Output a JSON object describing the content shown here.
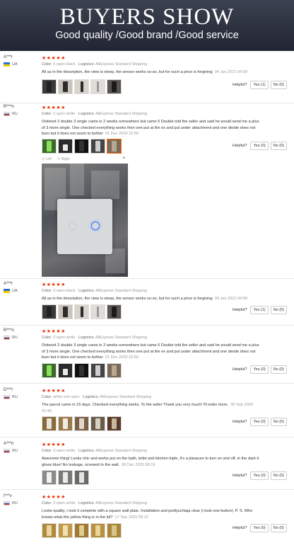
{
  "banner": {
    "title": "BUYERS SHOW",
    "subtitle": "Good quality /Good brand /Good service"
  },
  "labels": {
    "color": "Color:",
    "logistics": "Logistics:",
    "helpful": "Helpful?"
  },
  "viewer": {
    "left": "Left",
    "right": "Right",
    "close": "×"
  },
  "colors": {
    "star": "#e62e04",
    "accent": "#ff6a00"
  },
  "reviews": [
    {
      "author": "A***r",
      "country": "UA",
      "stars": "★★★★★",
      "color": "3 open black",
      "logistics": "AliExpress Standard Shipping",
      "text": "All as in the description, the view is steep, the sensor works so-so, but for such a price is forgiving",
      "date": "04 Jan 2021 04:58",
      "yes": "Yes (1)",
      "no": "No (0)"
    },
    {
      "author": "R***n",
      "country": "RU",
      "stars": "★★★★★",
      "color": "2 open white",
      "logistics": "AliExpress Standard Shipping",
      "text": "Ordered 2 double 3 single came in 2 weeks somewhere but came 5 Double told the seller and said he would send me a plus of 3 more single. One checked everything works then one put at the ex and put under attachment and one deode does not burn but it does not seem to bother",
      "date": "01 Dec 2020 22:50",
      "yes": "Yes (0)",
      "no": "No (0)"
    },
    {
      "author": "A***r",
      "country": "UA",
      "stars": "★★★★★",
      "color": "3 open black",
      "logistics": "AliExpress Standard Shipping",
      "text": "All as in the description, the view is steep, the sensor works so-so, but for such a price is forgiving",
      "date": "04 Jan 2021 04:58",
      "yes": "Yes (1)",
      "no": "No (0)"
    },
    {
      "author": "R***n",
      "country": "RU",
      "stars": "★★★★★",
      "color": "2 open white",
      "logistics": "AliExpress Standard Shipping",
      "text": "Ordered 2 double 3 single came in 2 weeks somewhere but came 5 Double told the seller and said he would send me a plus of 3 more single. One checked everything works then one put at the ex and put under attachment and one deode does not burn but it does not seem to bother",
      "date": "01 Dec 2020 22:50",
      "yes": "Yes (0)",
      "no": "No (0)"
    },
    {
      "author": "D***l",
      "country": "RU",
      "stars": "★★★★★",
      "color": "white one open",
      "logistics": "AliExpress Standard Shipping",
      "text": "The parcel came in 15 days. Checked everything works. To the seller Thank you very much! I'll order more.",
      "date": "30 Sep 2020 02:48",
      "yes": "Yes (0)",
      "no": "No (0)"
    },
    {
      "author": "A***n",
      "country": "RU",
      "stars": "★★★★★",
      "color": "3 open white",
      "logistics": "AliExpress Standard Shipping",
      "text": "Awesome thing! Looks chic and works put on the bath, toilet and kitchen triple, it's a pleasure to turn on and off, in the dark it glows blue! No leakage, screwed to the wall.",
      "date": "08 Dec 2020 08:19",
      "yes": "Yes (0)",
      "no": "No (0)"
    },
    {
      "author": "I***v",
      "country": "RU",
      "stars": "★★★★★",
      "color": "3 open white",
      "logistics": "AliExpress Standard Shipping",
      "text": "Looks quality, i took it complete with a square wall plate. Installation and podlyuchiaja clear (i took one button). P. S. Who knows what the yellow thing is in the kit?",
      "date": "17 Sep 2020 05:12",
      "yes": "Yes (0)",
      "no": "No (0)"
    }
  ]
}
